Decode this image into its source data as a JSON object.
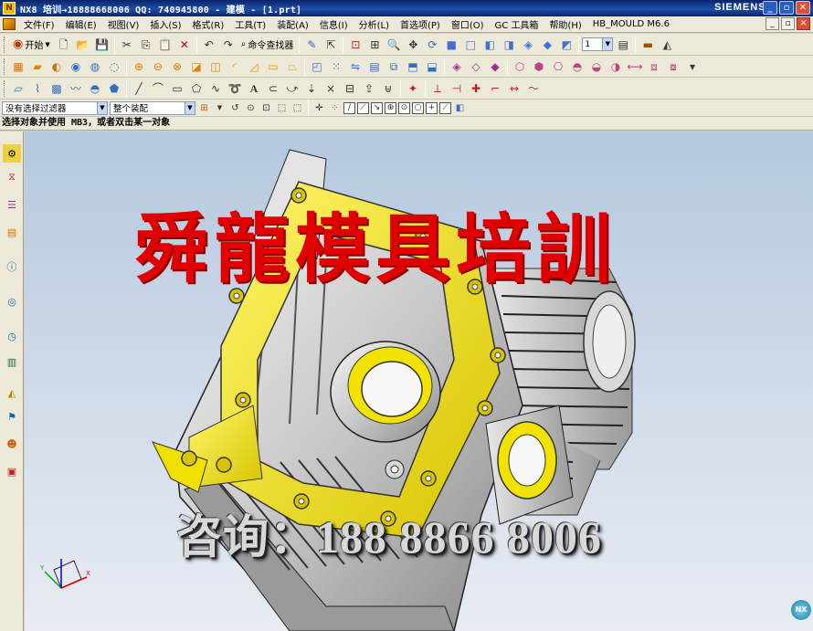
{
  "window": {
    "title": "NX8 培训→18888668006 QQ: 740945800 - 建模 - [1.prt]",
    "brand": "SIEMENS",
    "buttons": [
      "_",
      "▫",
      "✕"
    ]
  },
  "menu": {
    "items": [
      "文件(F)",
      "编辑(E)",
      "视图(V)",
      "插入(S)",
      "格式(R)",
      "工具(T)",
      "装配(A)",
      "信息(I)",
      "分析(L)",
      "首选项(P)",
      "窗口(O)",
      "GC 工具箱",
      "帮助(H)",
      "HB_MOULD M6.6"
    ]
  },
  "toolbar": {
    "start_label": "开始",
    "command_finder_label": "命令查找器",
    "layer_value": "1"
  },
  "filters": {
    "type_filter": "没有选择过滤器",
    "scope_filter": "整个装配"
  },
  "status": {
    "prompt": "选择对象并使用 MB3，或者双击某一对象"
  },
  "overlay": {
    "watermark": "舜龍模具培訓",
    "contact": "咨询：188  8866  8006"
  },
  "colors": {
    "titlebar": "#0a246a",
    "viewport_top": "#b4c8de",
    "face_highlight": "#f2e200",
    "watermark": "#e00000"
  },
  "icons": {
    "resource_bar": [
      "assembly-navigator-icon",
      "constraint-navigator-icon",
      "part-navigator-icon",
      "reuse-library-icon",
      "hd3d-tools-icon",
      "web-browser-icon",
      "history-icon",
      "process-studio-icon",
      "visualization-icon",
      "role-icon",
      "system-scenes-icon"
    ]
  }
}
